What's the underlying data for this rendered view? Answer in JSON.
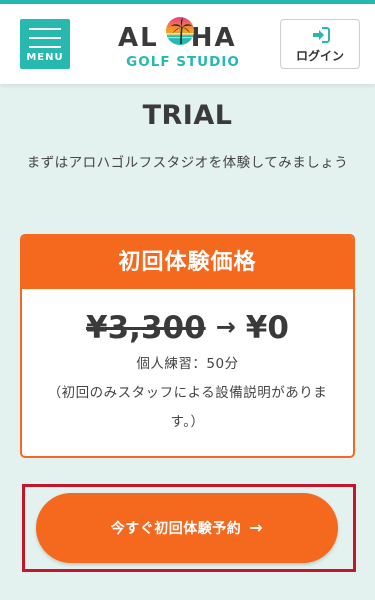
{
  "header": {
    "menu_label": "MENU",
    "logo_text_left": "AL",
    "logo_text_right": "HA",
    "logo_subtext": "GOLF STUDIO",
    "login_label": "ログイン"
  },
  "trial": {
    "title": "TRIAL",
    "description": "まずはアロハゴルフスタジオを体験してみましょう"
  },
  "price_card": {
    "header": "初回体験価格",
    "old_price": "¥3,300",
    "arrow": "→",
    "new_price": "¥0",
    "detail_line1": "個人練習：50分",
    "detail_line2": "（初回のみスタッフによる設備説明があります。）"
  },
  "cta": {
    "label": "今すぐ初回体験予約",
    "arrow": "→"
  },
  "colors": {
    "teal": "#27b8b0",
    "orange": "#f4691e",
    "highlight_border": "#c4162a",
    "background": "#e3f1ef"
  },
  "icons": {
    "menu": "hamburger-icon",
    "login": "sign-in-icon",
    "cta_arrow": "arrow-right-icon"
  }
}
